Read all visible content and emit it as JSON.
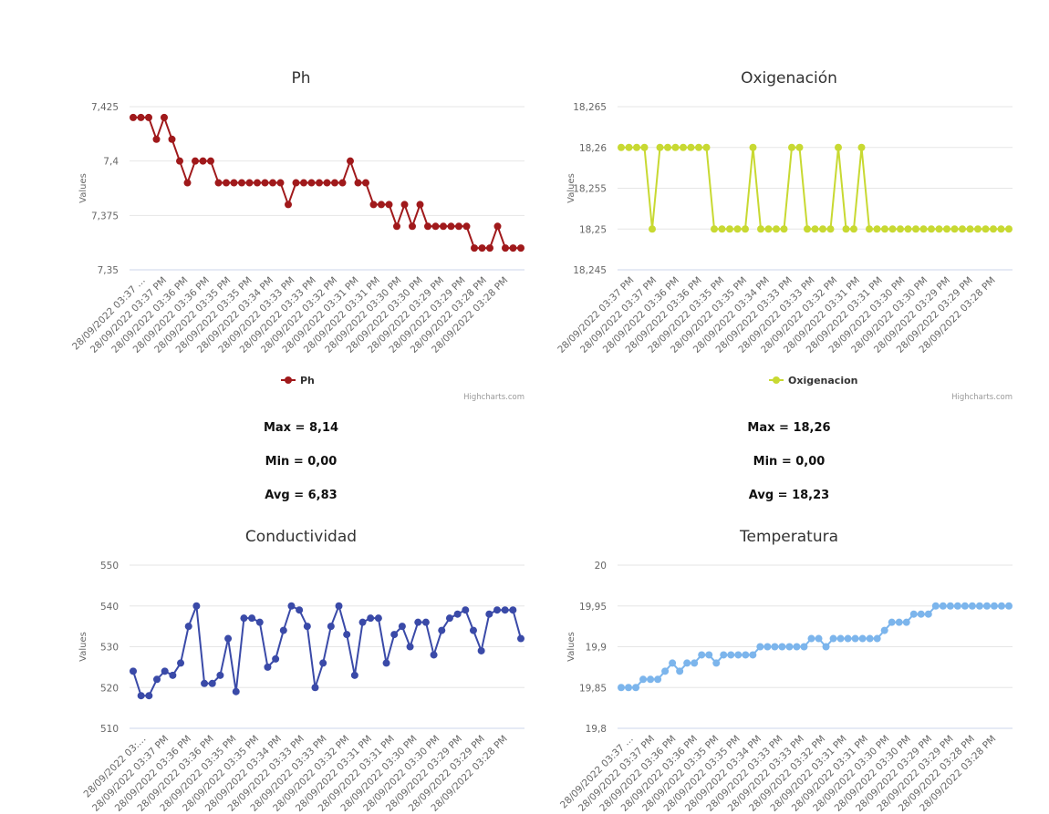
{
  "chart_data": [
    {
      "type": "line",
      "title": "Ph",
      "ylabel": "Values",
      "ylim": [
        7.35,
        7.425
      ],
      "yticks": [
        "7,425",
        "7,4",
        "7,375",
        "7,35"
      ],
      "yticks_values": [
        7.425,
        7.4,
        7.375,
        7.35
      ],
      "color": "#a0191b",
      "grid": true,
      "legend_position": "bottom-center",
      "credits": "Highcharts.com",
      "x_labels": [
        "28/09/2022 03:37 …",
        "28/09/2022 03:37 PM",
        "28/09/2022 03:36 PM",
        "28/09/2022 03:36 PM",
        "28/09/2022 03:35 PM",
        "28/09/2022 03:35 PM",
        "28/09/2022 03:34 PM",
        "28/09/2022 03:33 PM",
        "28/09/2022 03:33 PM",
        "28/09/2022 03:32 PM",
        "28/09/2022 03:31 PM",
        "28/09/2022 03:31 PM",
        "28/09/2022 03:30 PM",
        "28/09/2022 03:30 PM",
        "28/09/2022 03:29 PM",
        "28/09/2022 03:29 PM",
        "28/09/2022 03:28 PM",
        "28/09/2022 03:28 PM"
      ],
      "series": [
        {
          "name": "Ph",
          "values": [
            7.42,
            7.42,
            7.42,
            7.41,
            7.42,
            7.41,
            7.4,
            7.39,
            7.4,
            7.4,
            7.4,
            7.39,
            7.39,
            7.39,
            7.39,
            7.39,
            7.39,
            7.39,
            7.39,
            7.39,
            7.38,
            7.39,
            7.39,
            7.39,
            7.39,
            7.39,
            7.39,
            7.39,
            7.4,
            7.39,
            7.39,
            7.38,
            7.38,
            7.38,
            7.37,
            7.38,
            7.37,
            7.38,
            7.37,
            7.37,
            7.37,
            7.37,
            7.37,
            7.37,
            7.36,
            7.36,
            7.36,
            7.37,
            7.36,
            7.36,
            7.36
          ]
        }
      ]
    },
    {
      "type": "line",
      "title": "Oxigenación",
      "ylabel": "Values",
      "ylim": [
        18.245,
        18.265
      ],
      "yticks": [
        "18,265",
        "18,26",
        "18,255",
        "18,25",
        "18,245"
      ],
      "yticks_values": [
        18.265,
        18.26,
        18.255,
        18.25,
        18.245
      ],
      "color": "#c8d932",
      "grid": true,
      "legend_position": "bottom-center",
      "credits": "Highcharts.com",
      "x_labels": [
        "28/09/2022 03:37 PM",
        "28/09/2022 03:37 PM",
        "28/09/2022 03:36 PM",
        "28/09/2022 03:36 PM",
        "28/09/2022 03:35 PM",
        "28/09/2022 03:35 PM",
        "28/09/2022 03:34 PM",
        "28/09/2022 03:33 PM",
        "28/09/2022 03:33 PM",
        "28/09/2022 03:32 PM",
        "28/09/2022 03:31 PM",
        "28/09/2022 03:31 PM",
        "28/09/2022 03:30 PM",
        "28/09/2022 03:30 PM",
        "28/09/2022 03:29 PM",
        "28/09/2022 03:29 PM",
        "28/09/2022 03:28 PM"
      ],
      "series": [
        {
          "name": "Oxigenacion",
          "values": [
            18.26,
            18.26,
            18.26,
            18.26,
            18.25,
            18.26,
            18.26,
            18.26,
            18.26,
            18.26,
            18.26,
            18.26,
            18.25,
            18.25,
            18.25,
            18.25,
            18.25,
            18.26,
            18.25,
            18.25,
            18.25,
            18.25,
            18.26,
            18.26,
            18.25,
            18.25,
            18.25,
            18.25,
            18.26,
            18.25,
            18.25,
            18.26,
            18.25,
            18.25,
            18.25,
            18.25,
            18.25,
            18.25,
            18.25,
            18.25,
            18.25,
            18.25,
            18.25,
            18.25,
            18.25,
            18.25,
            18.25,
            18.25,
            18.25,
            18.25,
            18.25
          ]
        }
      ]
    },
    {
      "type": "line",
      "title": "Conductividad",
      "ylabel": "Values",
      "ylim": [
        510,
        550
      ],
      "yticks": [
        "550",
        "540",
        "530",
        "520",
        "510"
      ],
      "yticks_values": [
        550,
        540,
        530,
        520,
        510
      ],
      "color": "#3a4aa8",
      "grid": true,
      "x_labels": [
        "28/09/2022 03:…",
        "28/09/2022 03:37 PM",
        "28/09/2022 03:36 PM",
        "28/09/2022 03:36 PM",
        "28/09/2022 03:35 PM",
        "28/09/2022 03:35 PM",
        "28/09/2022 03:34 PM",
        "28/09/2022 03:33 PM",
        "28/09/2022 03:33 PM",
        "28/09/2022 03:32 PM",
        "28/09/2022 03:31 PM",
        "28/09/2022 03:31 PM",
        "28/09/2022 03:30 PM",
        "28/09/2022 03:30 PM",
        "28/09/2022 03:29 PM",
        "28/09/2022 03:29 PM",
        "28/09/2022 03:28 PM"
      ],
      "series": [
        {
          "name": "",
          "values": [
            524,
            518,
            518,
            522,
            524,
            523,
            526,
            535,
            540,
            521,
            521,
            523,
            532,
            519,
            537,
            537,
            536,
            525,
            527,
            534,
            540,
            539,
            535,
            520,
            526,
            535,
            540,
            533,
            523,
            536,
            537,
            537,
            526,
            533,
            535,
            530,
            536,
            536,
            528,
            534,
            537,
            538,
            539,
            534,
            529,
            538,
            539,
            539,
            539,
            532
          ]
        }
      ]
    },
    {
      "type": "line",
      "title": "Temperatura",
      "ylabel": "Values",
      "ylim": [
        19.8,
        20
      ],
      "yticks": [
        "20",
        "19,95",
        "19,9",
        "19,85",
        "19,8"
      ],
      "yticks_values": [
        20,
        19.95,
        19.9,
        19.85,
        19.8
      ],
      "color": "#7cb5ec",
      "grid": true,
      "x_labels": [
        "28/09/2022 03:37 …",
        "28/09/2022 03:37 PM",
        "28/09/2022 03:36 PM",
        "28/09/2022 03:36 PM",
        "28/09/2022 03:35 PM",
        "28/09/2022 03:35 PM",
        "28/09/2022 03:34 PM",
        "28/09/2022 03:33 PM",
        "28/09/2022 03:33 PM",
        "28/09/2022 03:32 PM",
        "28/09/2022 03:31 PM",
        "28/09/2022 03:31 PM",
        "28/09/2022 03:30 PM",
        "28/09/2022 03:30 PM",
        "28/09/2022 03:29 PM",
        "28/09/2022 03:29 PM",
        "28/09/2022 03:28 PM",
        "28/09/2022 03:28 PM"
      ],
      "series": [
        {
          "name": "",
          "values": [
            19.85,
            19.85,
            19.85,
            19.86,
            19.86,
            19.86,
            19.87,
            19.88,
            19.87,
            19.88,
            19.88,
            19.89,
            19.89,
            19.88,
            19.89,
            19.89,
            19.89,
            19.89,
            19.89,
            19.9,
            19.9,
            19.9,
            19.9,
            19.9,
            19.9,
            19.9,
            19.91,
            19.91,
            19.9,
            19.91,
            19.91,
            19.91,
            19.91,
            19.91,
            19.91,
            19.91,
            19.92,
            19.93,
            19.93,
            19.93,
            19.94,
            19.94,
            19.94,
            19.95,
            19.95,
            19.95,
            19.95,
            19.95,
            19.95,
            19.95,
            19.95,
            19.95,
            19.95,
            19.95
          ]
        }
      ]
    }
  ],
  "stats": [
    {
      "max": "Max = 8,14",
      "min": "Min = 0,00",
      "avg": "Avg = 6,83"
    },
    {
      "max": "Max = 18,26",
      "min": "Min = 0,00",
      "avg": "Avg = 18,23"
    }
  ]
}
